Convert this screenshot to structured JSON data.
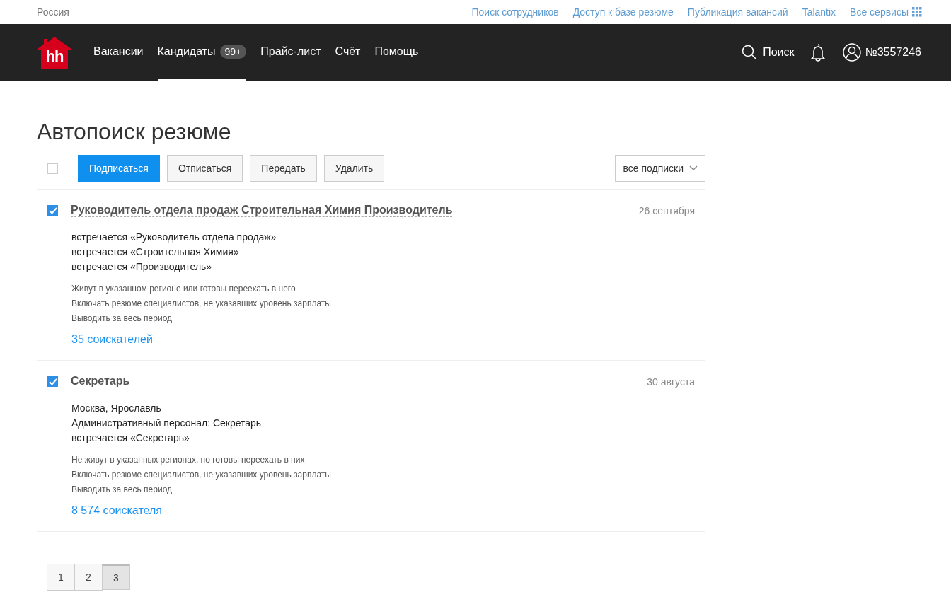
{
  "top_bar": {
    "region": "Россия",
    "links": [
      "Поиск сотрудников",
      "Доступ к базе резюме",
      "Публикация вакансий",
      "Talantix"
    ],
    "all_services": "Все сервисы"
  },
  "header": {
    "logo": "hh",
    "nav": [
      {
        "label": "Вакансии",
        "selected": false
      },
      {
        "label": "Кандидаты",
        "badge": "99+",
        "selected": true
      },
      {
        "label": "Прайс-лист",
        "selected": false
      },
      {
        "label": "Счёт",
        "selected": false
      },
      {
        "label": "Помощь",
        "selected": false
      }
    ],
    "search": "Поиск",
    "account": "№3557246"
  },
  "title": "Автопоиск резюме",
  "toolbar": {
    "select_all": {
      "checked": false
    },
    "buttons": [
      {
        "label": "Подписаться",
        "kind": "primary"
      },
      {
        "label": "Отписаться",
        "kind": "secondary"
      },
      {
        "label": "Передать",
        "kind": "secondary"
      },
      {
        "label": "Удалить",
        "kind": "secondary"
      }
    ],
    "filter": "все подписки"
  },
  "subscriptions": [
    {
      "title": "Руководитель отдела продаж Строительная Химия Производитель",
      "date": "26 сентября",
      "checked": true,
      "criteria": [
        "встречается «Руководитель отдела продаж»",
        "встречается «Строительная Химия»",
        "встречается «Производитель»"
      ],
      "options": [
        "Живут в указанном регионе или готовы переехать в него",
        "Включать резюме специалистов, не указавших уровень зарплаты",
        "Выводить за весь период"
      ],
      "count": "35 соискателей"
    },
    {
      "title": "Секретарь",
      "date": "30 августа",
      "checked": true,
      "criteria": [
        "Москва, Ярославль",
        "Административный персонал: Секретарь",
        "встречается «Секретарь»"
      ],
      "options": [
        "Не живут в указанных регионах, но готовы переехать в них",
        "Включать резюме специалистов, не указавших уровень зарплаты",
        "Выводить за весь период"
      ],
      "count": "8 574 соискателя"
    }
  ],
  "pagination": [
    {
      "label": "1",
      "selected": false
    },
    {
      "label": "2",
      "selected": false
    },
    {
      "label": "3",
      "selected": true
    }
  ]
}
